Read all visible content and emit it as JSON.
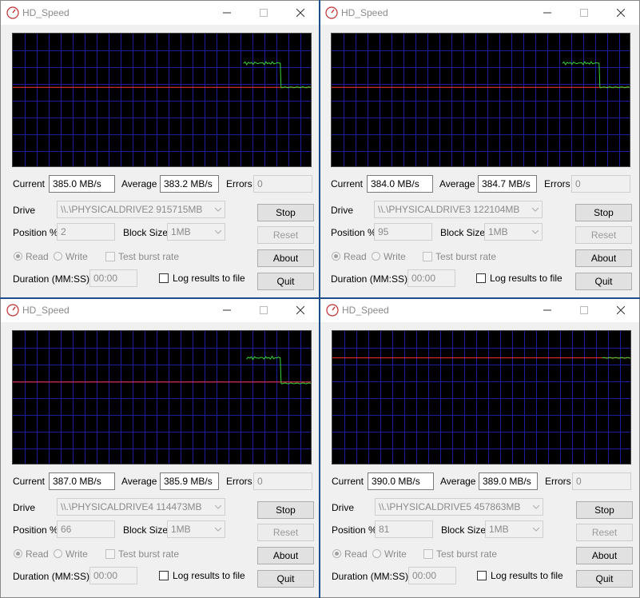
{
  "windows": [
    {
      "title": "HD_Speed",
      "current": "385.0 MB/s",
      "average": "383.2 MB/s",
      "errors": "0",
      "drive": "\\\\.\\PHYSICALDRIVE2   915715MB",
      "position": "2",
      "block_size": "1MB",
      "duration": "00:00",
      "graph": {
        "ref_level": 0.6,
        "burst_start": 0.77,
        "burst_end": 0.89,
        "burst_level": 0.78,
        "sustain_level": 0.6
      }
    },
    {
      "title": "HD_Speed",
      "current": "384.0 MB/s",
      "average": "384.7 MB/s",
      "errors": "0",
      "drive": "\\\\.\\PHYSICALDRIVE3   122104MB",
      "position": "95",
      "block_size": "1MB",
      "duration": "00:00",
      "graph": {
        "ref_level": 0.6,
        "burst_start": 0.77,
        "burst_end": 0.89,
        "burst_level": 0.78,
        "sustain_level": 0.6
      }
    },
    {
      "title": "HD_Speed",
      "current": "387.0 MB/s",
      "average": "385.9 MB/s",
      "errors": "0",
      "drive": "\\\\.\\PHYSICALDRIVE4   114473MB",
      "position": "66",
      "block_size": "1MB",
      "duration": "00:00",
      "graph": {
        "ref_level": 0.62,
        "burst_start": 0.78,
        "burst_end": 0.89,
        "burst_level": 0.8,
        "sustain_level": 0.61
      }
    },
    {
      "title": "HD_Speed",
      "current": "390.0 MB/s",
      "average": "389.0 MB/s",
      "errors": "0",
      "drive": "\\\\.\\PHYSICALDRIVE5   457863MB",
      "position": "81",
      "block_size": "1MB",
      "duration": "00:00",
      "graph": {
        "ref_level": 0.8,
        "burst_start": null,
        "burst_end": 0.9,
        "burst_level": 0.8,
        "sustain_level": 0.8
      }
    }
  ],
  "labels": {
    "current": "Current",
    "average": "Average",
    "errors": "Errors",
    "drive": "Drive",
    "position": "Position %",
    "block_size": "Block Size",
    "read": "Read",
    "write": "Write",
    "test_burst": "Test burst rate",
    "duration": "Duration (MM:SS)",
    "log": "Log results to file",
    "stop": "Stop",
    "reset": "Reset",
    "about": "About",
    "quit": "Quit"
  },
  "colors": {
    "graph_bg": "#000000",
    "grid": "#1c1ca0",
    "ref_line": "#ff3030",
    "trace": "#39d639"
  }
}
